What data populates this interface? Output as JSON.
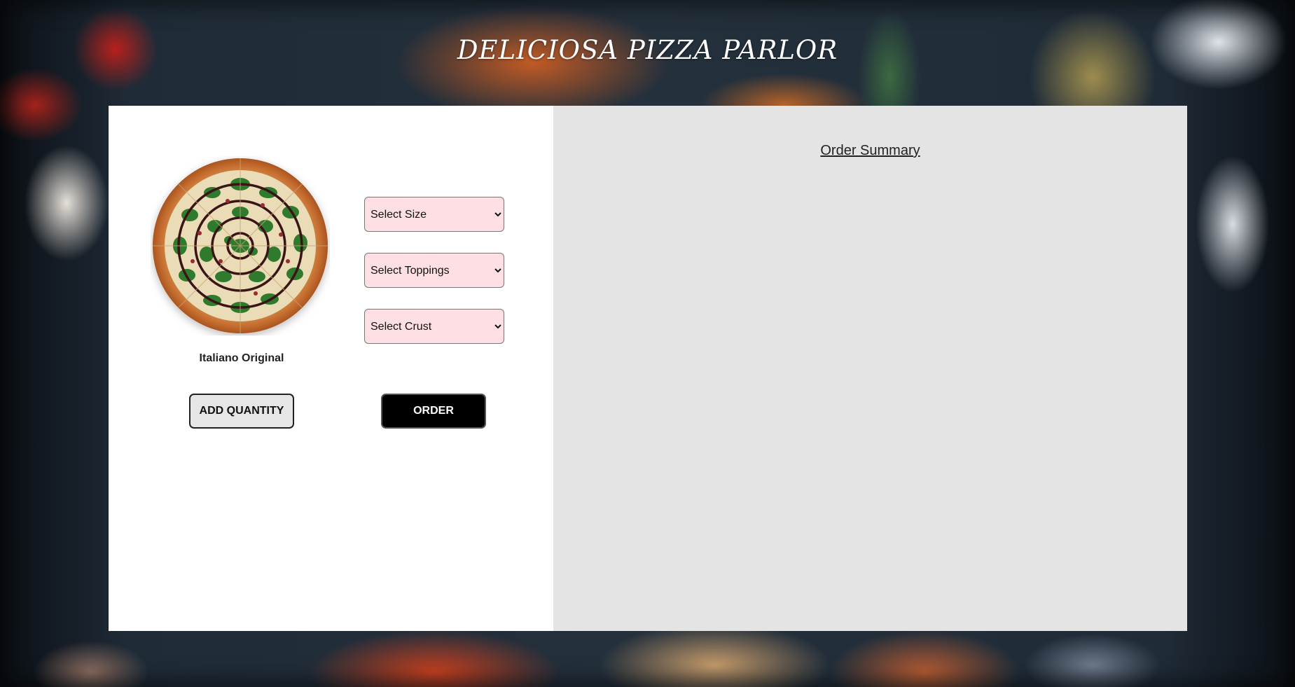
{
  "header": {
    "title": "DELICIOSA PIZZA PARLOR"
  },
  "pizza": {
    "name": "Italiano Original"
  },
  "selects": {
    "size": {
      "selected": "Select Size"
    },
    "toppings": {
      "selected": "Select Toppings"
    },
    "crust": {
      "selected": "Select Crust"
    }
  },
  "buttons": {
    "add_quantity": "ADD QUANTITY",
    "order": "ORDER"
  },
  "summary": {
    "title": "Order Summary"
  },
  "colors": {
    "select_bg": "#fedfe3",
    "order_button_bg": "#000000",
    "summary_bg": "#e4e4e4",
    "panel_bg": "#ffffff"
  },
  "icons": {
    "select_arrow": "chevron-down-icon",
    "pizza_image": "pizza-photo"
  }
}
